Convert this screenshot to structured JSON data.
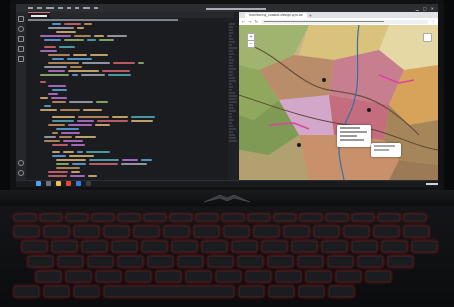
{
  "browser": {
    "tab_title": "monitoring_coastal-design.pyx.ko"
  },
  "map_controls": {
    "zoom_in": "+",
    "zoom_out": "−"
  },
  "colors": {
    "editor_bg": "#1b1c1f",
    "keyboard_backlight": "#ff2a2a",
    "tab_accent": "#e06c75"
  }
}
